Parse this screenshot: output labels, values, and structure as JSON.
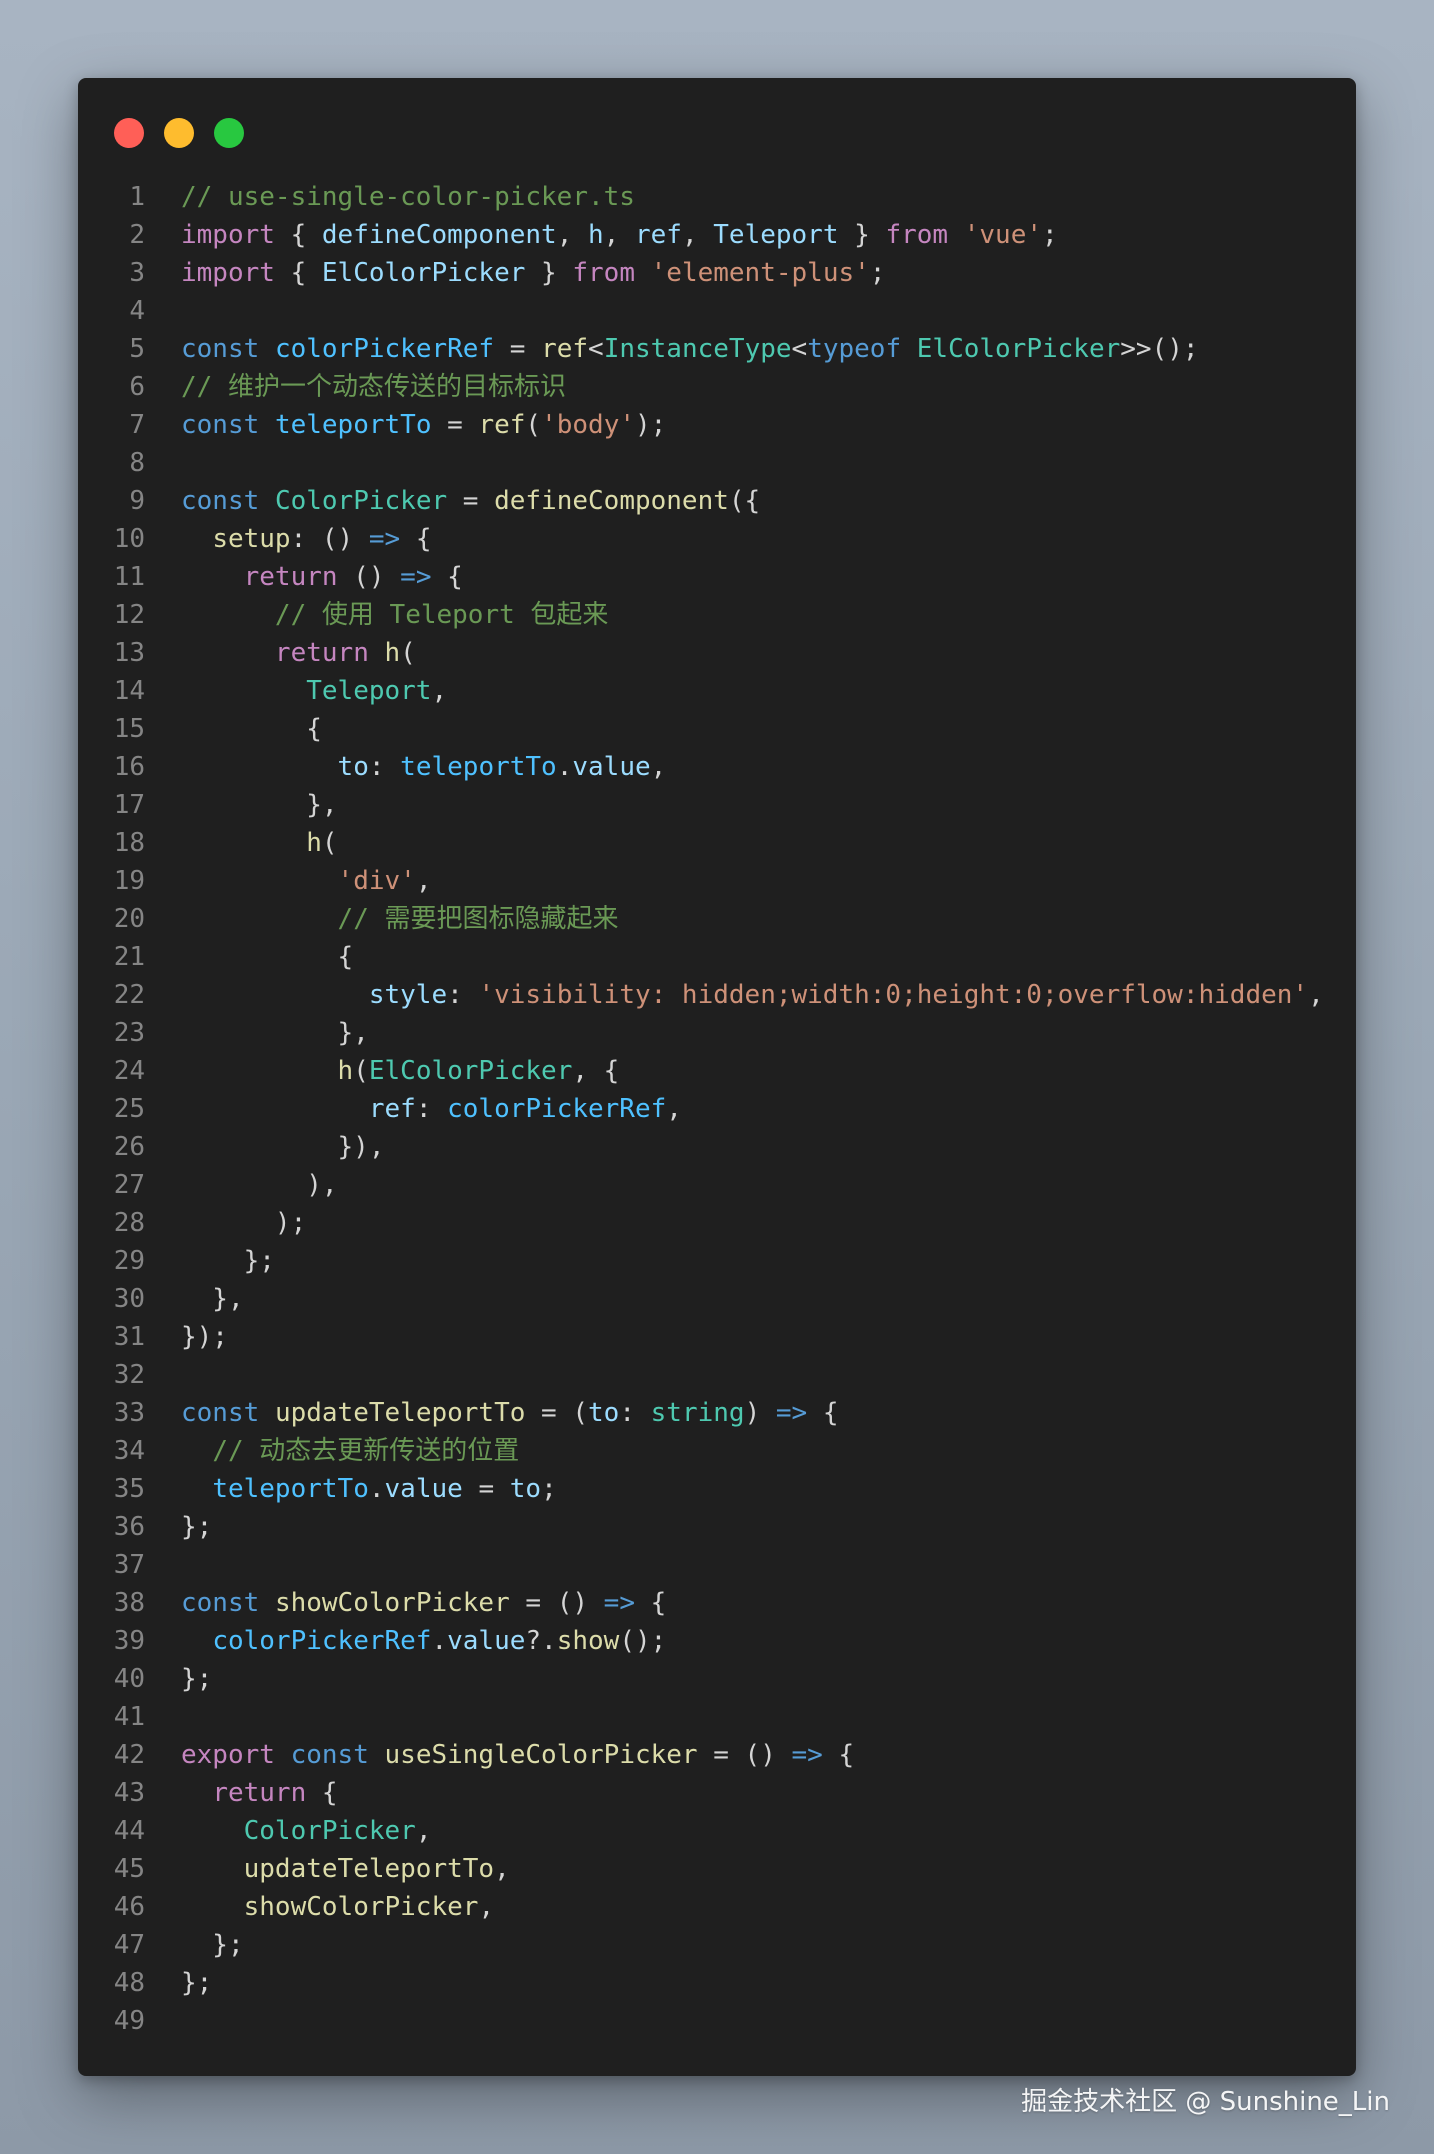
{
  "colors": {
    "background": "#a1adbb",
    "window": "#1f1f1f",
    "traffic_red": "#ff5f57",
    "traffic_yellow": "#febc2e",
    "traffic_green": "#28c840",
    "line_number": "#858585",
    "comment": "#6a9955",
    "keyword_blue": "#569cd6",
    "keyword_purple": "#c586c0",
    "function": "#dcdcaa",
    "variable": "#9cdcfe",
    "constant": "#4fc1ff",
    "type": "#4ec9b0",
    "string": "#ce9178",
    "text": "#d4d4d4"
  },
  "window": {
    "buttons": [
      "close-icon",
      "minimize-icon",
      "zoom-icon"
    ]
  },
  "code": {
    "language": "ts",
    "lines": [
      [
        [
          "// use-single-color-picker.ts",
          "#6a9955"
        ]
      ],
      [
        [
          "import",
          "#c586c0"
        ],
        [
          " { ",
          "#d4d4d4"
        ],
        [
          "defineComponent",
          "#9cdcfe"
        ],
        [
          ", ",
          "#d4d4d4"
        ],
        [
          "h",
          "#9cdcfe"
        ],
        [
          ", ",
          "#d4d4d4"
        ],
        [
          "ref",
          "#9cdcfe"
        ],
        [
          ", ",
          "#d4d4d4"
        ],
        [
          "Teleport",
          "#9cdcfe"
        ],
        [
          " } ",
          "#d4d4d4"
        ],
        [
          "from",
          "#c586c0"
        ],
        [
          " ",
          "#d4d4d4"
        ],
        [
          "'vue'",
          "#ce9178"
        ],
        [
          ";",
          "#d4d4d4"
        ]
      ],
      [
        [
          "import",
          "#c586c0"
        ],
        [
          " { ",
          "#d4d4d4"
        ],
        [
          "ElColorPicker",
          "#9cdcfe"
        ],
        [
          " } ",
          "#d4d4d4"
        ],
        [
          "from",
          "#c586c0"
        ],
        [
          " ",
          "#d4d4d4"
        ],
        [
          "'element-plus'",
          "#ce9178"
        ],
        [
          ";",
          "#d4d4d4"
        ]
      ],
      [],
      [
        [
          "const",
          "#569cd6"
        ],
        [
          " ",
          "#d4d4d4"
        ],
        [
          "colorPickerRef",
          "#4fc1ff"
        ],
        [
          " = ",
          "#d4d4d4"
        ],
        [
          "ref",
          "#dcdcaa"
        ],
        [
          "<",
          "#d4d4d4"
        ],
        [
          "InstanceType",
          "#4ec9b0"
        ],
        [
          "<",
          "#d4d4d4"
        ],
        [
          "typeof",
          "#569cd6"
        ],
        [
          " ",
          "#d4d4d4"
        ],
        [
          "ElColorPicker",
          "#4ec9b0"
        ],
        [
          ">>();",
          "#d4d4d4"
        ]
      ],
      [
        [
          "// 维护一个动态传送的目标标识",
          "#6a9955"
        ]
      ],
      [
        [
          "const",
          "#569cd6"
        ],
        [
          " ",
          "#d4d4d4"
        ],
        [
          "teleportTo",
          "#4fc1ff"
        ],
        [
          " = ",
          "#d4d4d4"
        ],
        [
          "ref",
          "#dcdcaa"
        ],
        [
          "(",
          "#d4d4d4"
        ],
        [
          "'body'",
          "#ce9178"
        ],
        [
          ");",
          "#d4d4d4"
        ]
      ],
      [],
      [
        [
          "const",
          "#569cd6"
        ],
        [
          " ",
          "#d4d4d4"
        ],
        [
          "ColorPicker",
          "#4ec9b0"
        ],
        [
          " = ",
          "#d4d4d4"
        ],
        [
          "defineComponent",
          "#dcdcaa"
        ],
        [
          "({",
          "#d4d4d4"
        ]
      ],
      [
        [
          "  ",
          "#d4d4d4"
        ],
        [
          "setup",
          "#dcdcaa"
        ],
        [
          ": () ",
          "#d4d4d4"
        ],
        [
          "=>",
          "#569cd6"
        ],
        [
          " {",
          "#d4d4d4"
        ]
      ],
      [
        [
          "    ",
          "#d4d4d4"
        ],
        [
          "return",
          "#c586c0"
        ],
        [
          " () ",
          "#d4d4d4"
        ],
        [
          "=>",
          "#569cd6"
        ],
        [
          " {",
          "#d4d4d4"
        ]
      ],
      [
        [
          "      ",
          "#d4d4d4"
        ],
        [
          "// 使用 Teleport 包起来",
          "#6a9955"
        ]
      ],
      [
        [
          "      ",
          "#d4d4d4"
        ],
        [
          "return",
          "#c586c0"
        ],
        [
          " ",
          "#d4d4d4"
        ],
        [
          "h",
          "#dcdcaa"
        ],
        [
          "(",
          "#d4d4d4"
        ]
      ],
      [
        [
          "        ",
          "#d4d4d4"
        ],
        [
          "Teleport",
          "#4ec9b0"
        ],
        [
          ",",
          "#d4d4d4"
        ]
      ],
      [
        [
          "        {",
          "#d4d4d4"
        ]
      ],
      [
        [
          "          ",
          "#d4d4d4"
        ],
        [
          "to",
          "#9cdcfe"
        ],
        [
          ": ",
          "#d4d4d4"
        ],
        [
          "teleportTo",
          "#4fc1ff"
        ],
        [
          ".",
          "#d4d4d4"
        ],
        [
          "value",
          "#9cdcfe"
        ],
        [
          ",",
          "#d4d4d4"
        ]
      ],
      [
        [
          "        },",
          "#d4d4d4"
        ]
      ],
      [
        [
          "        ",
          "#d4d4d4"
        ],
        [
          "h",
          "#dcdcaa"
        ],
        [
          "(",
          "#d4d4d4"
        ]
      ],
      [
        [
          "          ",
          "#d4d4d4"
        ],
        [
          "'div'",
          "#ce9178"
        ],
        [
          ",",
          "#d4d4d4"
        ]
      ],
      [
        [
          "          ",
          "#d4d4d4"
        ],
        [
          "// 需要把图标隐藏起来",
          "#6a9955"
        ]
      ],
      [
        [
          "          {",
          "#d4d4d4"
        ]
      ],
      [
        [
          "            ",
          "#d4d4d4"
        ],
        [
          "style",
          "#9cdcfe"
        ],
        [
          ": ",
          "#d4d4d4"
        ],
        [
          "'visibility: hidden;width:0;height:0;overflow:hidden'",
          "#ce9178"
        ],
        [
          ",",
          "#d4d4d4"
        ]
      ],
      [
        [
          "          },",
          "#d4d4d4"
        ]
      ],
      [
        [
          "          ",
          "#d4d4d4"
        ],
        [
          "h",
          "#dcdcaa"
        ],
        [
          "(",
          "#d4d4d4"
        ],
        [
          "ElColorPicker",
          "#4ec9b0"
        ],
        [
          ", {",
          "#d4d4d4"
        ]
      ],
      [
        [
          "            ",
          "#d4d4d4"
        ],
        [
          "ref",
          "#9cdcfe"
        ],
        [
          ": ",
          "#d4d4d4"
        ],
        [
          "colorPickerRef",
          "#4fc1ff"
        ],
        [
          ",",
          "#d4d4d4"
        ]
      ],
      [
        [
          "          }),",
          "#d4d4d4"
        ]
      ],
      [
        [
          "        ),",
          "#d4d4d4"
        ]
      ],
      [
        [
          "      );",
          "#d4d4d4"
        ]
      ],
      [
        [
          "    };",
          "#d4d4d4"
        ]
      ],
      [
        [
          "  },",
          "#d4d4d4"
        ]
      ],
      [
        [
          "});",
          "#d4d4d4"
        ]
      ],
      [],
      [
        [
          "const",
          "#569cd6"
        ],
        [
          " ",
          "#d4d4d4"
        ],
        [
          "updateTeleportTo",
          "#dcdcaa"
        ],
        [
          " = (",
          "#d4d4d4"
        ],
        [
          "to",
          "#9cdcfe"
        ],
        [
          ": ",
          "#d4d4d4"
        ],
        [
          "string",
          "#4ec9b0"
        ],
        [
          ") ",
          "#d4d4d4"
        ],
        [
          "=>",
          "#569cd6"
        ],
        [
          " {",
          "#d4d4d4"
        ]
      ],
      [
        [
          "  ",
          "#d4d4d4"
        ],
        [
          "// 动态去更新传送的位置",
          "#6a9955"
        ]
      ],
      [
        [
          "  ",
          "#d4d4d4"
        ],
        [
          "teleportTo",
          "#4fc1ff"
        ],
        [
          ".",
          "#d4d4d4"
        ],
        [
          "value",
          "#9cdcfe"
        ],
        [
          " = ",
          "#d4d4d4"
        ],
        [
          "to",
          "#9cdcfe"
        ],
        [
          ";",
          "#d4d4d4"
        ]
      ],
      [
        [
          "};",
          "#d4d4d4"
        ]
      ],
      [],
      [
        [
          "const",
          "#569cd6"
        ],
        [
          " ",
          "#d4d4d4"
        ],
        [
          "showColorPicker",
          "#dcdcaa"
        ],
        [
          " = () ",
          "#d4d4d4"
        ],
        [
          "=>",
          "#569cd6"
        ],
        [
          " {",
          "#d4d4d4"
        ]
      ],
      [
        [
          "  ",
          "#d4d4d4"
        ],
        [
          "colorPickerRef",
          "#4fc1ff"
        ],
        [
          ".",
          "#d4d4d4"
        ],
        [
          "value",
          "#9cdcfe"
        ],
        [
          "?.",
          "#d4d4d4"
        ],
        [
          "show",
          "#dcdcaa"
        ],
        [
          "();",
          "#d4d4d4"
        ]
      ],
      [
        [
          "};",
          "#d4d4d4"
        ]
      ],
      [],
      [
        [
          "export",
          "#c586c0"
        ],
        [
          " ",
          "#d4d4d4"
        ],
        [
          "const",
          "#569cd6"
        ],
        [
          " ",
          "#d4d4d4"
        ],
        [
          "useSingleColorPicker",
          "#dcdcaa"
        ],
        [
          " = () ",
          "#d4d4d4"
        ],
        [
          "=>",
          "#569cd6"
        ],
        [
          " {",
          "#d4d4d4"
        ]
      ],
      [
        [
          "  ",
          "#d4d4d4"
        ],
        [
          "return",
          "#c586c0"
        ],
        [
          " {",
          "#d4d4d4"
        ]
      ],
      [
        [
          "    ",
          "#d4d4d4"
        ],
        [
          "ColorPicker",
          "#4ec9b0"
        ],
        [
          ",",
          "#d4d4d4"
        ]
      ],
      [
        [
          "    ",
          "#d4d4d4"
        ],
        [
          "updateTeleportTo",
          "#dcdcaa"
        ],
        [
          ",",
          "#d4d4d4"
        ]
      ],
      [
        [
          "    ",
          "#d4d4d4"
        ],
        [
          "showColorPicker",
          "#dcdcaa"
        ],
        [
          ",",
          "#d4d4d4"
        ]
      ],
      [
        [
          "  };",
          "#d4d4d4"
        ]
      ],
      [
        [
          "};",
          "#d4d4d4"
        ]
      ],
      []
    ]
  },
  "watermark": {
    "text": "掘金技术社区 @ Sunshine_Lin"
  }
}
